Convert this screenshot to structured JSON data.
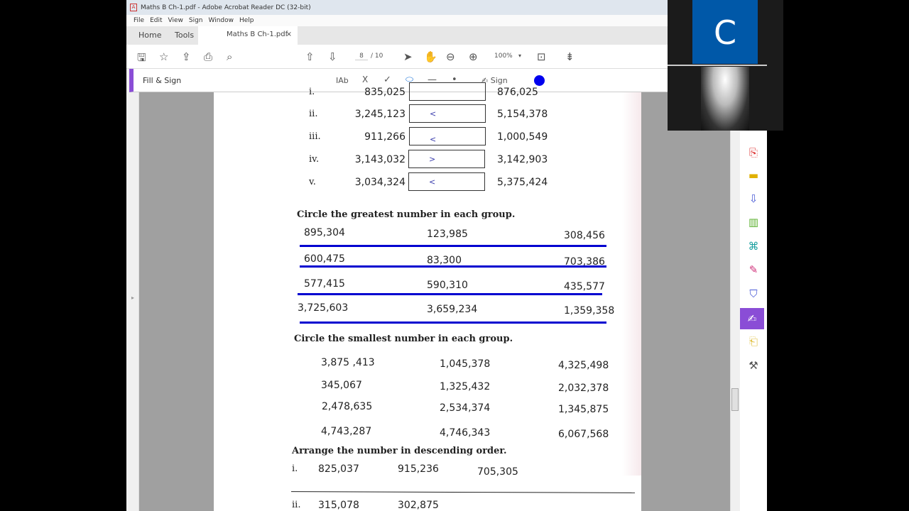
{
  "window": {
    "title": "Maths B Ch-1.pdf - Adobe Acrobat Reader DC (32-bit)"
  },
  "menu": [
    "File",
    "Edit",
    "View",
    "Sign",
    "Window",
    "Help"
  ],
  "tabs": {
    "home": "Home",
    "tools": "Tools",
    "doc": "Maths B Ch-1.pdf",
    "close": "×"
  },
  "toolbar": {
    "page_current": "8",
    "page_total": "/ 10",
    "zoom": "100%"
  },
  "fillsign": {
    "title": "Fill & Sign",
    "text_tool": "IAb",
    "cross": "X",
    "check": "✓",
    "sign": "Sign",
    "color": "#0000ee"
  },
  "video": {
    "initial": "C",
    "tile_color": "#0058a8"
  },
  "doc": {
    "compare_rows": [
      {
        "label": "i.",
        "left": "835,025",
        "sym": "",
        "right": "876,025"
      },
      {
        "label": "ii.",
        "left": "3,245,123",
        "sym": "<",
        "right": "5,154,378"
      },
      {
        "label": "iii.",
        "left": "911,266",
        "sym": "<",
        "right": "1,000,549"
      },
      {
        "label": "iv.",
        "left": "3,143,032",
        "sym": ">",
        "right": "3,142,903"
      },
      {
        "label": "v.",
        "left": "3,034,324",
        "sym": "<",
        "right": "5,375,424"
      }
    ],
    "greatest_heading": "Circle the greatest number in each group.",
    "greatest": [
      [
        "895,304",
        "123,985",
        "308,456"
      ],
      [
        "600,475",
        "83,300",
        "703,386"
      ],
      [
        "577,415",
        "590,310",
        "435,577"
      ],
      [
        "3,725,603",
        "3,659,234",
        "1,359,358"
      ]
    ],
    "smallest_heading": "Circle the smallest number in each group.",
    "smallest": [
      [
        "3,875 ,413",
        "1,045,378",
        "4,325,498"
      ],
      [
        "345,067",
        "1,325,432",
        "2,032,378"
      ],
      [
        "2,478,635",
        "2,534,374",
        "1,345,875"
      ],
      [
        "4,743,287",
        "4,746,343",
        "6,067,568"
      ]
    ],
    "arrange_heading": "Arrange the number in descending order.",
    "arrange": [
      {
        "label": "i.",
        "values": [
          "825,037",
          "915,236",
          "705,305"
        ]
      },
      {
        "label": "ii.",
        "values": [
          "315,078",
          "302,875",
          ""
        ]
      }
    ]
  }
}
